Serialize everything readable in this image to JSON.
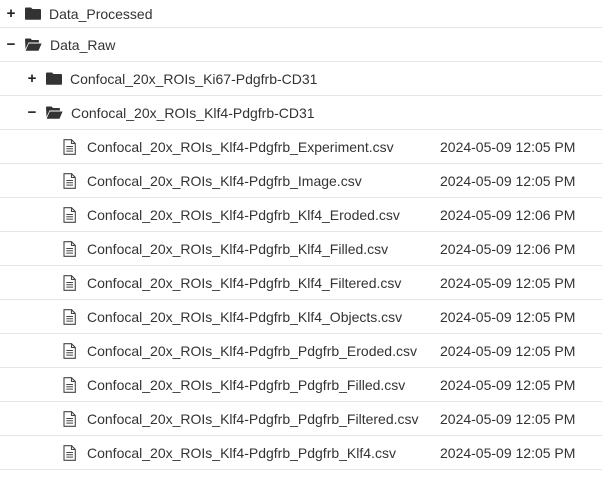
{
  "tree": {
    "data_processed": {
      "toggle": "+",
      "name": "Data_Processed",
      "icon": "folder-closed-icon"
    },
    "data_raw": {
      "toggle": "−",
      "name": "Data_Raw",
      "icon": "folder-open-icon"
    },
    "ki67": {
      "toggle": "+",
      "name": "Confocal_20x_ROIs_Ki67-Pdgfrb-CD31",
      "icon": "folder-closed-icon"
    },
    "klf4": {
      "toggle": "−",
      "name": "Confocal_20x_ROIs_Klf4-Pdgfrb-CD31",
      "icon": "folder-open-icon"
    },
    "files": [
      {
        "name": "Confocal_20x_ROIs_Klf4-Pdgfrb_Experiment.csv",
        "date": "2024-05-09 12:05 PM"
      },
      {
        "name": "Confocal_20x_ROIs_Klf4-Pdgfrb_Image.csv",
        "date": "2024-05-09 12:05 PM"
      },
      {
        "name": "Confocal_20x_ROIs_Klf4-Pdgfrb_Klf4_Eroded.csv",
        "date": "2024-05-09 12:06 PM"
      },
      {
        "name": "Confocal_20x_ROIs_Klf4-Pdgfrb_Klf4_Filled.csv",
        "date": "2024-05-09 12:06 PM"
      },
      {
        "name": "Confocal_20x_ROIs_Klf4-Pdgfrb_Klf4_Filtered.csv",
        "date": "2024-05-09 12:05 PM"
      },
      {
        "name": "Confocal_20x_ROIs_Klf4-Pdgfrb_Klf4_Objects.csv",
        "date": "2024-05-09 12:05 PM"
      },
      {
        "name": "Confocal_20x_ROIs_Klf4-Pdgfrb_Pdgfrb_Eroded.csv",
        "date": "2024-05-09 12:05 PM"
      },
      {
        "name": "Confocal_20x_ROIs_Klf4-Pdgfrb_Pdgfrb_Filled.csv",
        "date": "2024-05-09 12:05 PM"
      },
      {
        "name": "Confocal_20x_ROIs_Klf4-Pdgfrb_Pdgfrb_Filtered.csv",
        "date": "2024-05-09 12:05 PM"
      },
      {
        "name": "Confocal_20x_ROIs_Klf4-Pdgfrb_Pdgfrb_Klf4.csv",
        "date": "2024-05-09 12:05 PM"
      }
    ]
  },
  "colors": {
    "icon": "#333333",
    "divider": "#e6e6e6",
    "text": "#333333"
  }
}
